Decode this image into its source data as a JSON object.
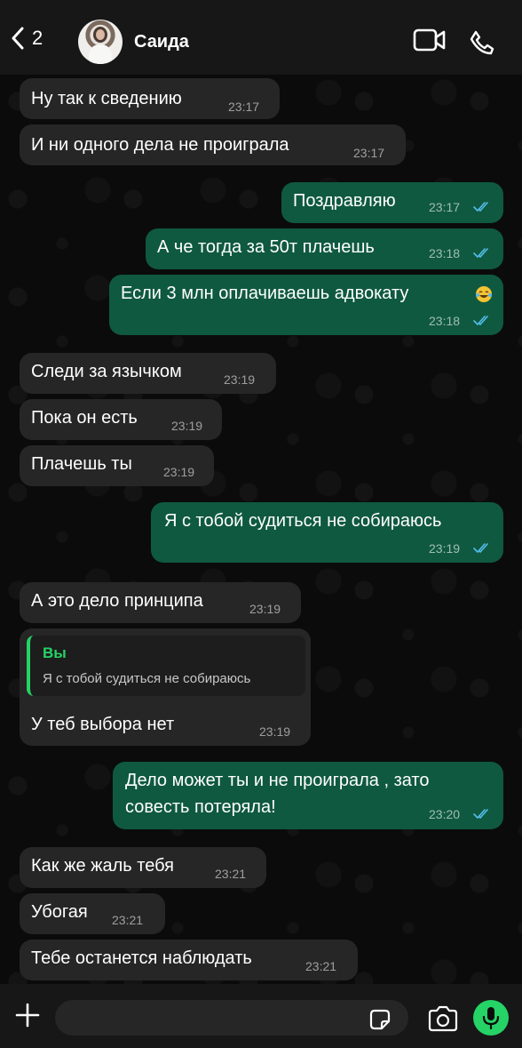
{
  "header": {
    "back_count": "2",
    "contact_name": "Саида"
  },
  "messages": [
    {
      "dir": "in",
      "text": "Ну так к сведению",
      "time": "23:17"
    },
    {
      "dir": "in",
      "text": "И ни одного дела не проиграла",
      "time": "23:17"
    },
    {
      "dir": "out",
      "text": "Поздравляю",
      "time": "23:17",
      "status": "read"
    },
    {
      "dir": "out",
      "text": "А че тогда за 50т плачешь",
      "time": "23:18",
      "status": "read"
    },
    {
      "dir": "out",
      "text": "Если 3 млн оплачиваешь адвокату",
      "emoji": "laughing-with-tears",
      "time": "23:18",
      "status": "read"
    },
    {
      "dir": "in",
      "text": "Следи за язычком",
      "time": "23:19"
    },
    {
      "dir": "in",
      "text": "Пока он есть",
      "time": "23:19"
    },
    {
      "dir": "in",
      "text": "Плачешь ты",
      "time": "23:19"
    },
    {
      "dir": "out",
      "text": "Я с тобой судиться не собираюсь",
      "time": "23:19",
      "status": "read"
    },
    {
      "dir": "in",
      "text": "А это дело принципа",
      "time": "23:19"
    },
    {
      "dir": "in",
      "text": "У теб выбора нет",
      "time": "23:19",
      "quote": {
        "author": "Вы",
        "text": "Я с тобой судиться не собираюсь"
      }
    },
    {
      "dir": "out",
      "text": "Дело может ты и не проиграла , зато\nсовесть потеряла!",
      "time": "23:20",
      "status": "read"
    },
    {
      "dir": "in",
      "text": "Как же жаль тебя",
      "time": "23:21"
    },
    {
      "dir": "in",
      "text": "Убогая",
      "time": "23:21"
    },
    {
      "dir": "in",
      "text": "Тебе останется наблюдать",
      "time": "23:21"
    }
  ],
  "colors": {
    "incoming_bubble": "#262626",
    "outgoing_bubble": "#0f5940",
    "accent": "#25d366",
    "read_ticks": "#53bdeb"
  },
  "composer": {
    "message_value": "",
    "icons": [
      "plus-icon",
      "sticker-icon",
      "camera-icon",
      "mic-icon"
    ]
  }
}
